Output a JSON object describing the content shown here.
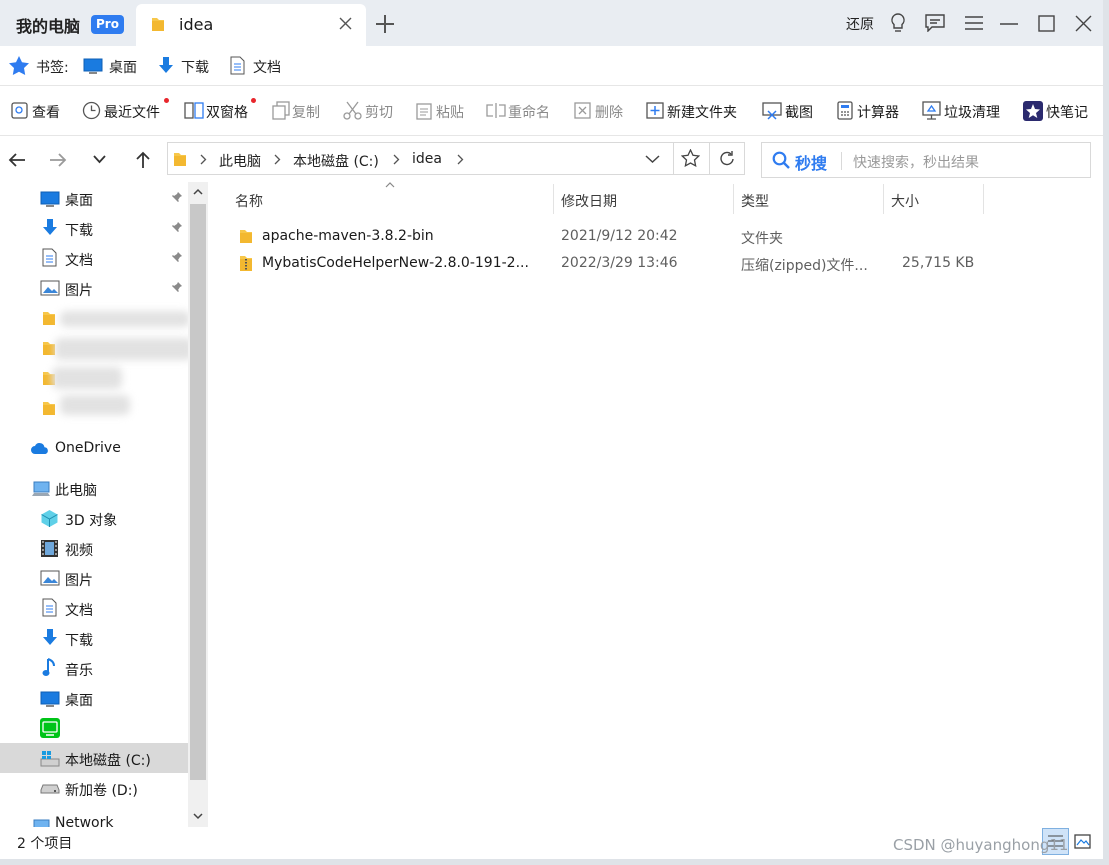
{
  "titlebar": {
    "app_name": "我的电脑",
    "pro_badge": "Pro",
    "tab_title": "idea",
    "restore_label": "还原"
  },
  "bookmarks": {
    "label": "书签:",
    "items": [
      "桌面",
      "下载",
      "文档"
    ]
  },
  "toolbar": {
    "items": [
      "查看",
      "最近文件",
      "双窗格",
      "复制",
      "剪切",
      "粘贴",
      "重命名",
      "删除",
      "新建文件夹",
      "截图",
      "计算器",
      "垃圾清理",
      "快笔记"
    ]
  },
  "address": {
    "crumbs": [
      "此电脑",
      "本地磁盘 (C:)",
      "idea"
    ]
  },
  "search": {
    "button_label": "秒搜",
    "placeholder": "快速搜索，秒出结果"
  },
  "sidebar": {
    "quick_access": [
      "桌面",
      "下载",
      "文档",
      "图片"
    ],
    "onedrive": "OneDrive",
    "this_pc": "此电脑",
    "pc_items": [
      "3D 对象",
      "视频",
      "图片",
      "文档",
      "下载",
      "音乐",
      "桌面"
    ],
    "drive_c": "本地磁盘 (C:)",
    "drive_d": "新加卷 (D:)",
    "network": "Network"
  },
  "filelist": {
    "columns": [
      "名称",
      "修改日期",
      "类型",
      "大小"
    ],
    "rows": [
      {
        "name": "apache-maven-3.8.2-bin",
        "date": "2021/9/12 20:42",
        "type": "文件夹",
        "size": ""
      },
      {
        "name": "MybatisCodeHelperNew-2.8.0-191-2...",
        "date": "2022/3/29 13:46",
        "type": "压缩(zipped)文件...",
        "size": "25,715 KB"
      }
    ]
  },
  "status": {
    "count": "2 个项目"
  },
  "watermark": "CSDN @huyanghong11",
  "colors": {
    "accent": "#2f7cf0",
    "folder": "#f7c74a",
    "titlebar_bg": "#e9edf2",
    "selected_bg": "#d9d9d9"
  }
}
